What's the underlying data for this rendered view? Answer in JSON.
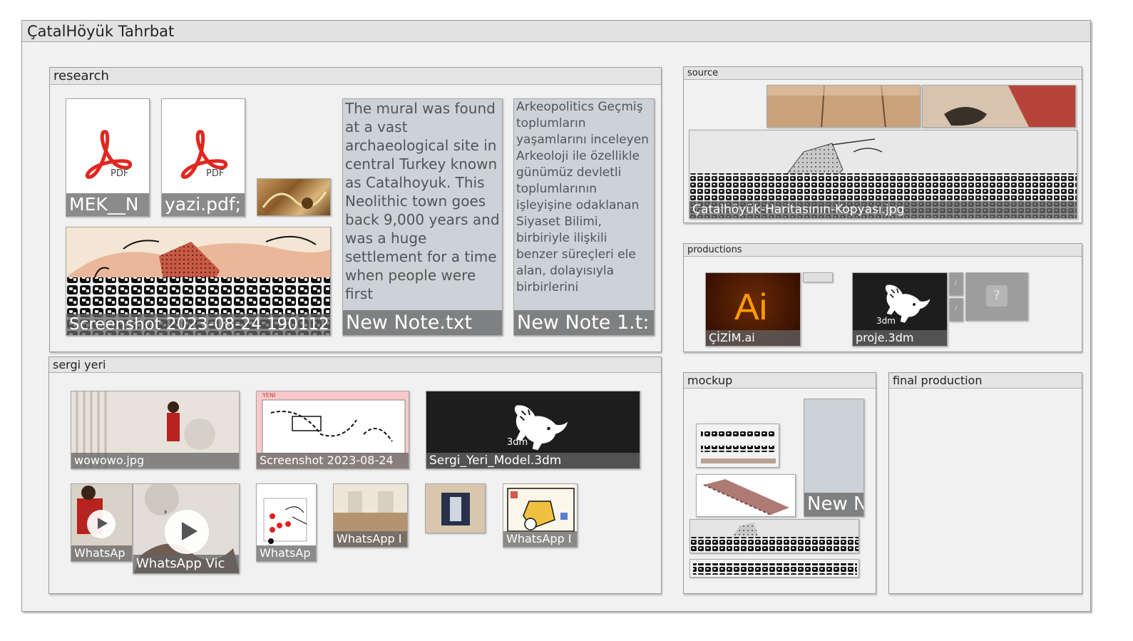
{
  "board": {
    "title": "ÇatalHöyük Tahrbat"
  },
  "research": {
    "title": "research",
    "pdf_label": "PDF",
    "files": [
      {
        "name": "MEK__N"
      },
      {
        "name": "yazi.pdf;"
      }
    ],
    "screenshot": {
      "name": "Screenshot 2023-08-24 190112"
    },
    "notes": [
      {
        "title": "New Note.txt",
        "text": "The mural was found at a vast archaeological site in central Turkey known as Catalhoyuk. This Neolithic town goes back 9,000 years and was a huge settlement for a time when people were first"
      },
      {
        "title": "New Note 1.t:",
        "text": "Arkeopolitics Geçmiş toplumların yaşamlarını inceleyen Arkeoloji ile özellikle günümüz devletli toplumlarının işleyişine odaklanan Siyaset Bilimi, birbiriyle ilişkili benzer süreçleri ele alan, dolayısıyla birbirlerini"
      }
    ]
  },
  "sergi": {
    "title": "sergi yeri",
    "items": [
      {
        "name": "wowowo.jpg"
      },
      {
        "name": "Screenshot 2023-08-24"
      },
      {
        "name": "Sergi_Yeri_Model.3dm"
      },
      {
        "name": "WhatsAp"
      },
      {
        "name": "WhatsApp Vic"
      },
      {
        "name": "WhatsAp"
      },
      {
        "name": "WhatsApp I"
      },
      {
        "name": "WhatsApp I"
      }
    ],
    "yeni_label": "YENİ",
    "model_label": "3dm"
  },
  "source": {
    "title": "source",
    "map_name": "Çatalhöyük-Haritasının-Kopyası.jpg"
  },
  "productions": {
    "title": "productions",
    "ai_label": "Ai",
    "ai_name": "ÇİZİM.ai",
    "rhino_label": "3dm",
    "rhino_name": "proje.3dm",
    "unknown_label": "?",
    "mini_label": "/"
  },
  "mockup": {
    "title": "mockup",
    "note_name": "New N"
  },
  "final": {
    "title": "final production"
  },
  "colors": {
    "note_bg": "#cdd2d8",
    "acrobat_red": "#e0271f",
    "ai_orange": "#ff9a00",
    "ai_bg": "#330000"
  }
}
